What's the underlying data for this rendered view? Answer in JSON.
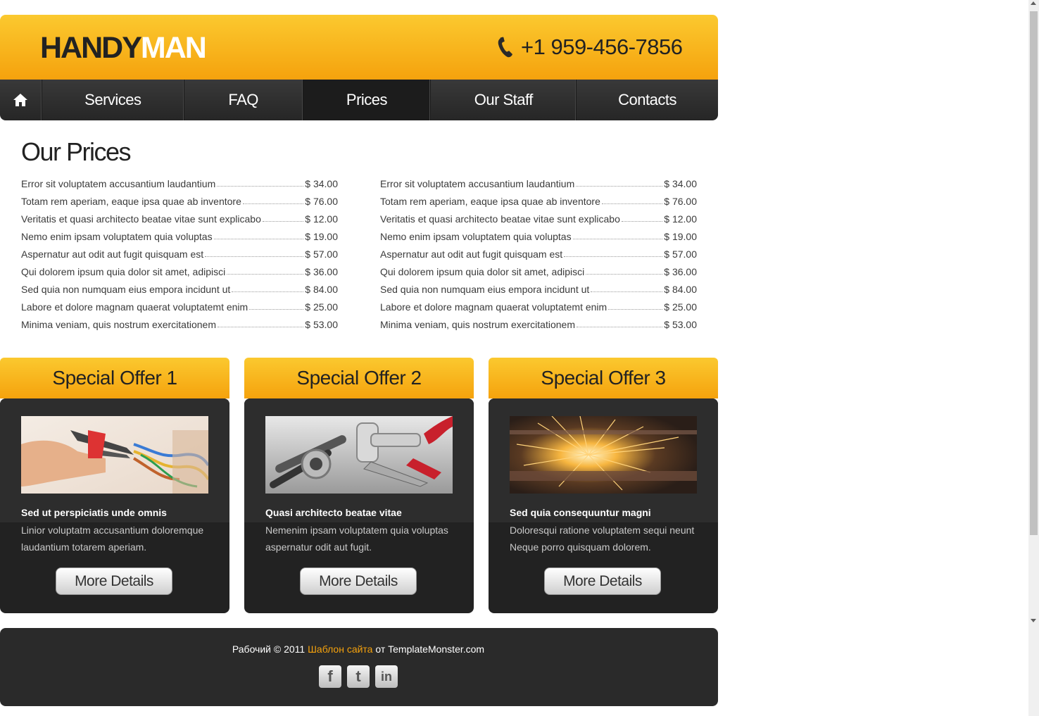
{
  "header": {
    "logo_part1": "HANDY",
    "logo_part2": "MAN",
    "phone_icon": "phone-icon",
    "phone": "+1 959-456-7856"
  },
  "nav": {
    "home_icon": "home-icon",
    "items": [
      "Services",
      "FAQ",
      "Prices",
      "Our Staff",
      "Contacts"
    ],
    "active": "Prices"
  },
  "prices": {
    "title": "Our Prices",
    "left": [
      {
        "name": "Error sit voluptatem accusantium laudantium",
        "price": "$ 34.00"
      },
      {
        "name": "Totam rem aperiam, eaque ipsa quae ab inventore",
        "price": "$ 76.00"
      },
      {
        "name": "Veritatis et quasi architecto beatae vitae sunt explicabo",
        "price": "$ 12.00"
      },
      {
        "name": "Nemo enim ipsam voluptatem quia voluptas",
        "price": "$ 19.00"
      },
      {
        "name": "Aspernatur aut odit aut fugit quisquam est",
        "price": "$ 57.00"
      },
      {
        "name": "Qui dolorem ipsum quia dolor sit amet, adipisci",
        "price": "$ 36.00"
      },
      {
        "name": "Sed quia non numquam eius empora incidunt ut",
        "price": "$ 84.00"
      },
      {
        "name": "Labore et dolore magnam quaerat voluptatemt enim",
        "price": "$ 25.00"
      },
      {
        "name": "Minima veniam, quis nostrum exercitationem",
        "price": "$ 53.00"
      }
    ],
    "right": [
      {
        "name": "Error sit voluptatem accusantium laudantium",
        "price": "$ 34.00"
      },
      {
        "name": "Totam rem aperiam, eaque ipsa quae ab inventore",
        "price": "$ 76.00"
      },
      {
        "name": "Veritatis et quasi architecto beatae vitae sunt explicabo",
        "price": "$ 12.00"
      },
      {
        "name": "Nemo enim ipsam voluptatem quia voluptas",
        "price": "$ 19.00"
      },
      {
        "name": "Aspernatur aut odit aut fugit quisquam est",
        "price": "$ 57.00"
      },
      {
        "name": "Qui dolorem ipsum quia dolor sit amet, adipisci",
        "price": "$ 36.00"
      },
      {
        "name": "Sed quia non numquam eius empora incidunt ut",
        "price": "$ 84.00"
      },
      {
        "name": "Labore et dolore magnam quaerat voluptatemt enim",
        "price": "$ 25.00"
      },
      {
        "name": "Minima veniam, quis nostrum exercitationem",
        "price": "$ 53.00"
      }
    ]
  },
  "offers": [
    {
      "title": "Special Offer 1",
      "heading": "Sed ut perspiciatis unde omnis",
      "text": "Linior voluptatm accusantium doloremque laudantium totarem aperiam.",
      "button": "More Details",
      "image": "pliers-wires-photo"
    },
    {
      "title": "Special Offer 2",
      "heading": "Quasi architecto beatae vitae",
      "text": "Nemenim ipsam voluptatem quia voluptas aspernatur odit aut fugit.",
      "button": "More Details",
      "image": "plumbing-tools-photo"
    },
    {
      "title": "Special Offer 3",
      "heading": "Sed quia consequuntur magni",
      "text": "Doloresqui ratione voluptatem sequi neunt Neque porro quisquam dolorem.",
      "button": "More Details",
      "image": "welding-sparks-photo"
    }
  ],
  "footer": {
    "prefix": "Рабочий © 2011 ",
    "link": "Шаблон сайта",
    "suffix": " от TemplateMonster.com",
    "social": [
      {
        "icon": "facebook-icon",
        "glyph": "f"
      },
      {
        "icon": "twitter-icon",
        "glyph": "t"
      },
      {
        "icon": "linkedin-icon",
        "glyph": "in"
      }
    ]
  },
  "colors": {
    "accent": "#f5a20d",
    "dark": "#222222"
  }
}
